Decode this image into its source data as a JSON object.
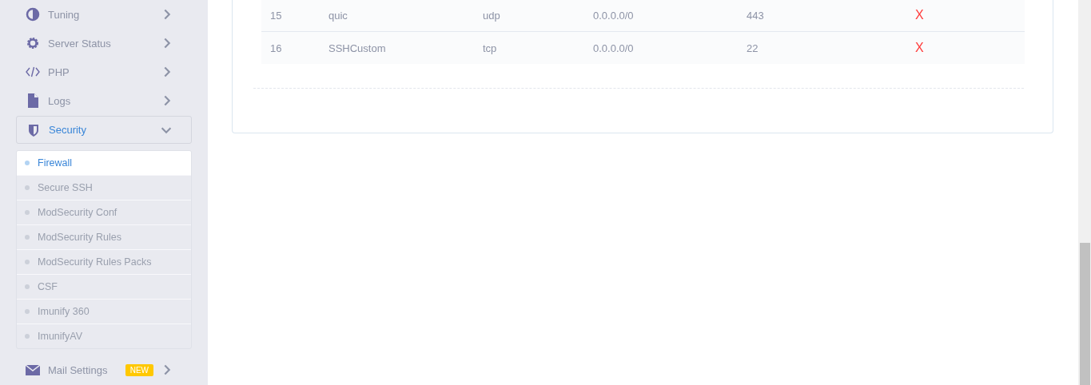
{
  "sidebar": {
    "items": [
      {
        "label": "Tuning",
        "kind": "half",
        "expanded": false
      },
      {
        "label": "Server Status",
        "kind": "gear",
        "expanded": false
      },
      {
        "label": "PHP",
        "kind": "code",
        "expanded": false
      },
      {
        "label": "Logs",
        "kind": "file",
        "expanded": false
      },
      {
        "label": "Security",
        "kind": "shield",
        "expanded": true,
        "children": [
          {
            "label": "Firewall",
            "selected": true
          },
          {
            "label": "Secure SSH",
            "selected": false
          },
          {
            "label": "ModSecurity Conf",
            "selected": false
          },
          {
            "label": "ModSecurity Rules",
            "selected": false
          },
          {
            "label": "ModSecurity Rules Packs",
            "selected": false
          },
          {
            "label": "CSF",
            "selected": false
          },
          {
            "label": "Imunify 360",
            "selected": false
          },
          {
            "label": "ImunifyAV",
            "selected": false
          }
        ]
      },
      {
        "label": "Mail Settings",
        "kind": "mail",
        "expanded": false,
        "badge": "NEW"
      }
    ]
  },
  "table": {
    "rows": [
      {
        "cells": [
          "15",
          "quic",
          "udp",
          "0.0.0.0/0",
          "443"
        ],
        "delete": "X"
      },
      {
        "cells": [
          "16",
          "SSHCustom",
          "tcp",
          "0.0.0.0/0",
          "22"
        ],
        "delete": "X"
      }
    ]
  }
}
